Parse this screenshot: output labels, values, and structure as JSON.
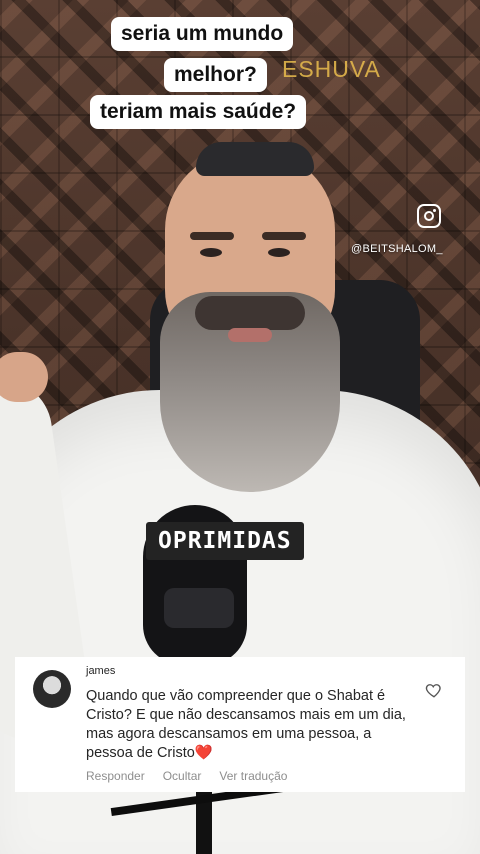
{
  "video": {
    "captions": [
      "seria um mundo",
      "melhor?",
      "teriam mais saúde?"
    ],
    "brand_text": "ESHUVA",
    "instagram_handle": "@BEITSHALOM_",
    "subtitle": "OPRIMIDAS"
  },
  "comment": {
    "username": "james",
    "text": "Quando que vão compreender que o Shabat é Cristo? E que não descansamos mais em um dia, mas agora descansamos em uma pessoa, a pessoa de Cristo",
    "emoji": "❤️",
    "actions": {
      "reply": "Responder",
      "hide": "Ocultar",
      "translate": "Ver tradução"
    }
  },
  "colors": {
    "caption_bg": "#ffffff",
    "brand": "#e2b64c",
    "subtitle_bg": "#232323",
    "muted": "#8e8e8e"
  },
  "icons": [
    "instagram-icon",
    "heart-outline-icon",
    "red-heart-emoji"
  ]
}
